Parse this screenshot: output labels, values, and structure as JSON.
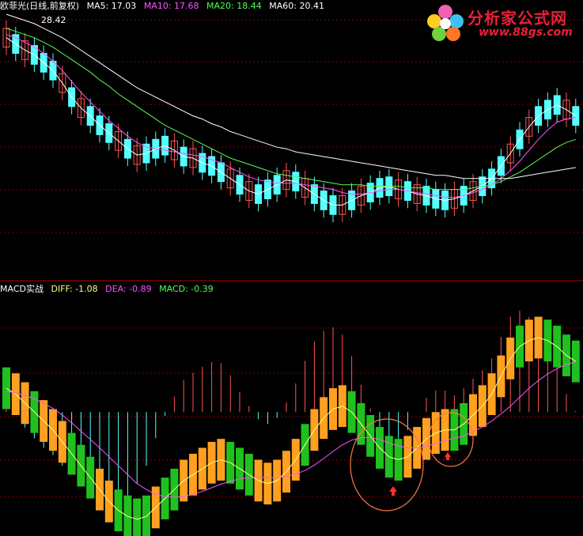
{
  "main_header": {
    "stock": "欧菲光(日线,前复权)",
    "ma5": "MA5: 17.03",
    "ma10": "MA10: 17.68",
    "ma20": "MA20: 18.44",
    "ma60": "MA60: 20.41",
    "peak_label": "28.42"
  },
  "macd_header": {
    "name": "MACD实战",
    "diff": "DIFF: -1.08",
    "dea": "DEA: -0.89",
    "macd": "MACD: -0.39"
  },
  "watermark": {
    "brand": "分析家公式网",
    "url": "www.88gs.com"
  },
  "colors": {
    "up": "#ff5454",
    "down": "#54ffff",
    "ma5": "#ffffff",
    "ma10": "#ff54ff",
    "ma20": "#54ff54",
    "ma60": "#ffffff",
    "diff": "#ffff88",
    "dea": "#ff54ff",
    "macd_label": "#54ff54",
    "block_orange": "#ffa020",
    "block_green": "#20c020",
    "divider": "#aa0000",
    "grid": "#8b0000"
  },
  "chart_data": [
    {
      "type": "candlestick",
      "title": "欧菲光(日线,前复权)",
      "series": [
        {
          "name": "MA5",
          "values": [
            28.0,
            27.6,
            27.2,
            26.9,
            26.4,
            25.9,
            25.1,
            24.2,
            23.5,
            23.0,
            22.4,
            21.9,
            21.4,
            20.9,
            20.5,
            20.6,
            20.9,
            21.1,
            20.8,
            20.4,
            20.3,
            20.0,
            19.8,
            19.4,
            19.0,
            18.6,
            18.2,
            18.0,
            18.3,
            18.6,
            18.9,
            18.8,
            18.4,
            18.0,
            17.6,
            17.3,
            17.3,
            17.6,
            17.9,
            18.1,
            18.4,
            18.5,
            18.3,
            18.2,
            18.0,
            17.9,
            17.7,
            17.6,
            17.7,
            17.9,
            18.2,
            18.5,
            19.0,
            19.8,
            20.6,
            21.5,
            22.3,
            23.0,
            23.4,
            23.7,
            23.4,
            23.0
          ]
        },
        {
          "name": "MA10",
          "values": [
            28.2,
            28.0,
            27.7,
            27.4,
            27.0,
            26.5,
            25.9,
            25.2,
            24.5,
            23.9,
            23.3,
            22.7,
            22.2,
            21.7,
            21.3,
            21.0,
            20.9,
            20.8,
            20.7,
            20.6,
            20.5,
            20.4,
            20.2,
            20.0,
            19.7,
            19.4,
            19.1,
            18.9,
            18.8,
            18.7,
            18.7,
            18.7,
            18.6,
            18.5,
            18.4,
            18.3,
            18.1,
            18.0,
            18.0,
            18.1,
            18.2,
            18.3,
            18.3,
            18.2,
            18.1,
            18.0,
            17.9,
            17.8,
            17.8,
            17.9,
            18.1,
            18.3,
            18.6,
            19.0,
            19.5,
            20.1,
            20.8,
            21.5,
            22.1,
            22.6,
            22.8,
            22.9
          ]
        },
        {
          "name": "MA20",
          "values": [
            28.6,
            28.4,
            28.2,
            28.0,
            27.7,
            27.4,
            27.0,
            26.6,
            26.2,
            25.8,
            25.3,
            24.9,
            24.4,
            24.0,
            23.6,
            23.2,
            22.8,
            22.4,
            22.1,
            21.8,
            21.5,
            21.2,
            20.9,
            20.6,
            20.3,
            20.1,
            19.9,
            19.7,
            19.5,
            19.3,
            19.2,
            19.1,
            19.0,
            18.9,
            18.8,
            18.7,
            18.6,
            18.6,
            18.6,
            18.5,
            18.5,
            18.5,
            18.5,
            18.4,
            18.4,
            18.4,
            18.3,
            18.3,
            18.3,
            18.3,
            18.4,
            18.5,
            18.6,
            18.8,
            19.1,
            19.4,
            19.8,
            20.2,
            20.6,
            21.0,
            21.3,
            21.5
          ]
        },
        {
          "name": "MA60",
          "values": [
            29.5,
            29.3,
            29.1,
            28.9,
            28.6,
            28.3,
            28.0,
            27.6,
            27.2,
            26.8,
            26.4,
            26.0,
            25.6,
            25.2,
            24.8,
            24.5,
            24.2,
            23.9,
            23.6,
            23.3,
            23.0,
            22.8,
            22.5,
            22.3,
            22.0,
            21.8,
            21.6,
            21.4,
            21.2,
            21.0,
            20.9,
            20.7,
            20.6,
            20.5,
            20.4,
            20.3,
            20.2,
            20.1,
            20.0,
            19.9,
            19.8,
            19.7,
            19.6,
            19.5,
            19.4,
            19.3,
            19.2,
            19.2,
            19.1,
            19.0,
            19.0,
            19.0,
            19.0,
            19.0,
            19.0,
            19.1,
            19.2,
            19.3,
            19.4,
            19.5,
            19.6,
            19.7
          ]
        }
      ],
      "peak": 28.42
    },
    {
      "type": "line",
      "title": "MACD实战",
      "series": [
        {
          "name": "DIFF",
          "values": [
            0.4,
            0.3,
            0.15,
            0.0,
            -0.15,
            -0.3,
            -0.5,
            -0.7,
            -0.9,
            -1.1,
            -1.3,
            -1.5,
            -1.65,
            -1.75,
            -1.8,
            -1.75,
            -1.6,
            -1.45,
            -1.3,
            -1.15,
            -1.05,
            -0.95,
            -0.85,
            -0.8,
            -0.85,
            -0.95,
            -1.05,
            -1.15,
            -1.2,
            -1.15,
            -1.0,
            -0.8,
            -0.55,
            -0.3,
            -0.1,
            0.05,
            0.1,
            0.0,
            -0.2,
            -0.4,
            -0.6,
            -0.75,
            -0.8,
            -0.75,
            -0.6,
            -0.45,
            -0.35,
            -0.3,
            -0.3,
            -0.2,
            -0.05,
            0.1,
            0.3,
            0.6,
            0.9,
            1.1,
            1.2,
            1.25,
            1.2,
            1.1,
            0.95,
            0.85
          ]
        },
        {
          "name": "DEA",
          "values": [
            0.35,
            0.32,
            0.28,
            0.22,
            0.15,
            0.06,
            -0.05,
            -0.18,
            -0.32,
            -0.46,
            -0.6,
            -0.75,
            -0.9,
            -1.05,
            -1.2,
            -1.3,
            -1.38,
            -1.42,
            -1.43,
            -1.42,
            -1.38,
            -1.33,
            -1.27,
            -1.21,
            -1.16,
            -1.12,
            -1.1,
            -1.09,
            -1.1,
            -1.1,
            -1.08,
            -1.04,
            -0.98,
            -0.89,
            -0.78,
            -0.66,
            -0.55,
            -0.47,
            -0.43,
            -0.43,
            -0.46,
            -0.52,
            -0.57,
            -0.6,
            -0.6,
            -0.57,
            -0.53,
            -0.48,
            -0.44,
            -0.4,
            -0.33,
            -0.25,
            -0.15,
            -0.03,
            0.1,
            0.25,
            0.4,
            0.53,
            0.64,
            0.73,
            0.8,
            0.84
          ]
        }
      ],
      "histogram": [
        0.1,
        0.0,
        -0.26,
        -0.44,
        -0.6,
        -0.72,
        -0.9,
        -1.04,
        -1.16,
        -1.28,
        -1.4,
        -1.5,
        -1.5,
        -1.4,
        -1.2,
        -0.9,
        -0.44,
        -0.06,
        0.26,
        0.54,
        0.66,
        0.76,
        0.84,
        0.82,
        0.62,
        0.34,
        0.1,
        -0.12,
        -0.2,
        -0.1,
        0.16,
        0.48,
        0.86,
        1.18,
        1.36,
        1.42,
        1.3,
        0.94,
        0.46,
        0.06,
        -0.28,
        -0.46,
        -0.46,
        -0.3,
        0.0,
        0.24,
        0.36,
        0.36,
        0.28,
        0.4,
        0.56,
        0.7,
        0.9,
        1.26,
        1.6,
        1.7,
        1.6,
        1.44,
        1.12,
        0.74,
        0.3,
        0.02
      ],
      "blocks": [
        0,
        1,
        1,
        0,
        1,
        1,
        1,
        0,
        0,
        0,
        1,
        1,
        0,
        0,
        0,
        0,
        1,
        0,
        0,
        1,
        1,
        1,
        1,
        1,
        0,
        0,
        0,
        1,
        1,
        1,
        1,
        1,
        0,
        1,
        1,
        1,
        1,
        0,
        0,
        0,
        0,
        0,
        0,
        1,
        1,
        1,
        1,
        1,
        0,
        0,
        1,
        1,
        1,
        1,
        1,
        0,
        1,
        1,
        0,
        0,
        0,
        0
      ]
    }
  ]
}
